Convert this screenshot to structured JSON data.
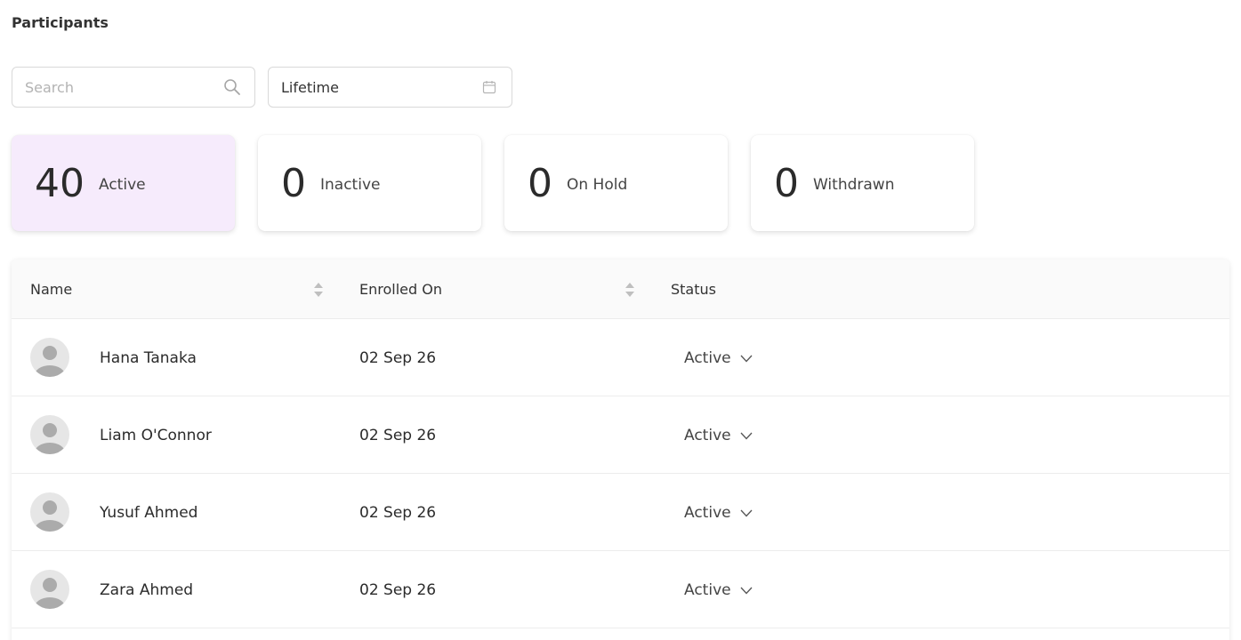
{
  "page": {
    "title": "Participants"
  },
  "filters": {
    "search_placeholder": "Search",
    "search_value": "",
    "date_range_value": "Lifetime"
  },
  "stats": [
    {
      "count": "40",
      "label": "Active",
      "selected": true
    },
    {
      "count": "0",
      "label": "Inactive",
      "selected": false
    },
    {
      "count": "0",
      "label": "On Hold",
      "selected": false
    },
    {
      "count": "0",
      "label": "Withdrawn",
      "selected": false
    }
  ],
  "table": {
    "columns": {
      "name": "Name",
      "enrolled_on": "Enrolled On",
      "status": "Status"
    },
    "rows": [
      {
        "name": "Hana Tanaka",
        "enrolled_on": "02 Sep 26",
        "status": "Active"
      },
      {
        "name": "Liam O'Connor",
        "enrolled_on": "02 Sep 26",
        "status": "Active"
      },
      {
        "name": "Yusuf Ahmed",
        "enrolled_on": "02 Sep 26",
        "status": "Active"
      },
      {
        "name": "Zara Ahmed",
        "enrolled_on": "02 Sep 26",
        "status": "Active"
      }
    ]
  },
  "icons": {
    "search": "search-icon",
    "calendar": "calendar-icon",
    "sort": "sort-icon",
    "avatar": "user-avatar-icon",
    "dropdown": "chevron-down-icon"
  },
  "colors": {
    "selected_card": "#f6ebfc",
    "header_bg": "#fafafa",
    "border": "#d9d9d9"
  }
}
